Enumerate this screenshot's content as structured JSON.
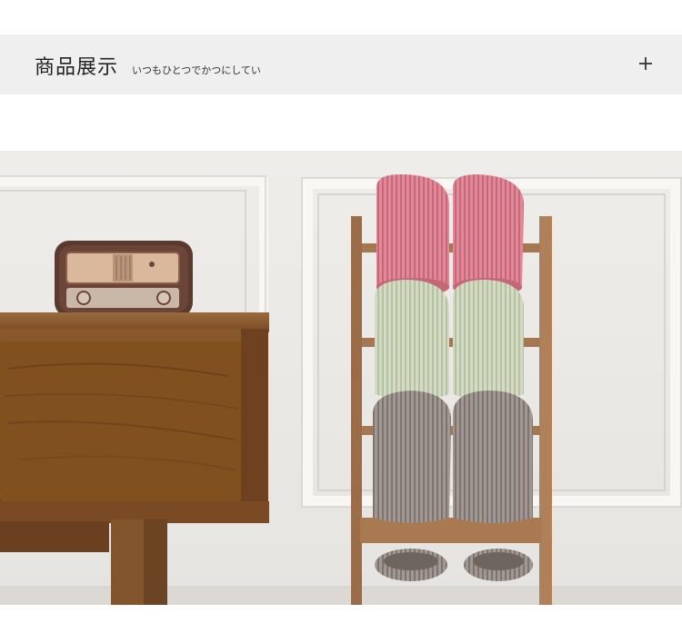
{
  "header": {
    "title": "商品展示",
    "subtitle": "いつもひとつでかつにしてい",
    "expand_icon": "plus-icon"
  },
  "photo": {
    "subject": "product-photo",
    "colors": {
      "wall": "#eceae6",
      "panel_molding": "#f6f5f2",
      "floor": "#d9d6d1",
      "cabinet_wood": "#7a4a22",
      "ladder_wood": "#a77a55",
      "slipper_pink": "#d9788a",
      "slipper_green": "#c9d2b8",
      "slipper_grey": "#8f8783"
    }
  }
}
